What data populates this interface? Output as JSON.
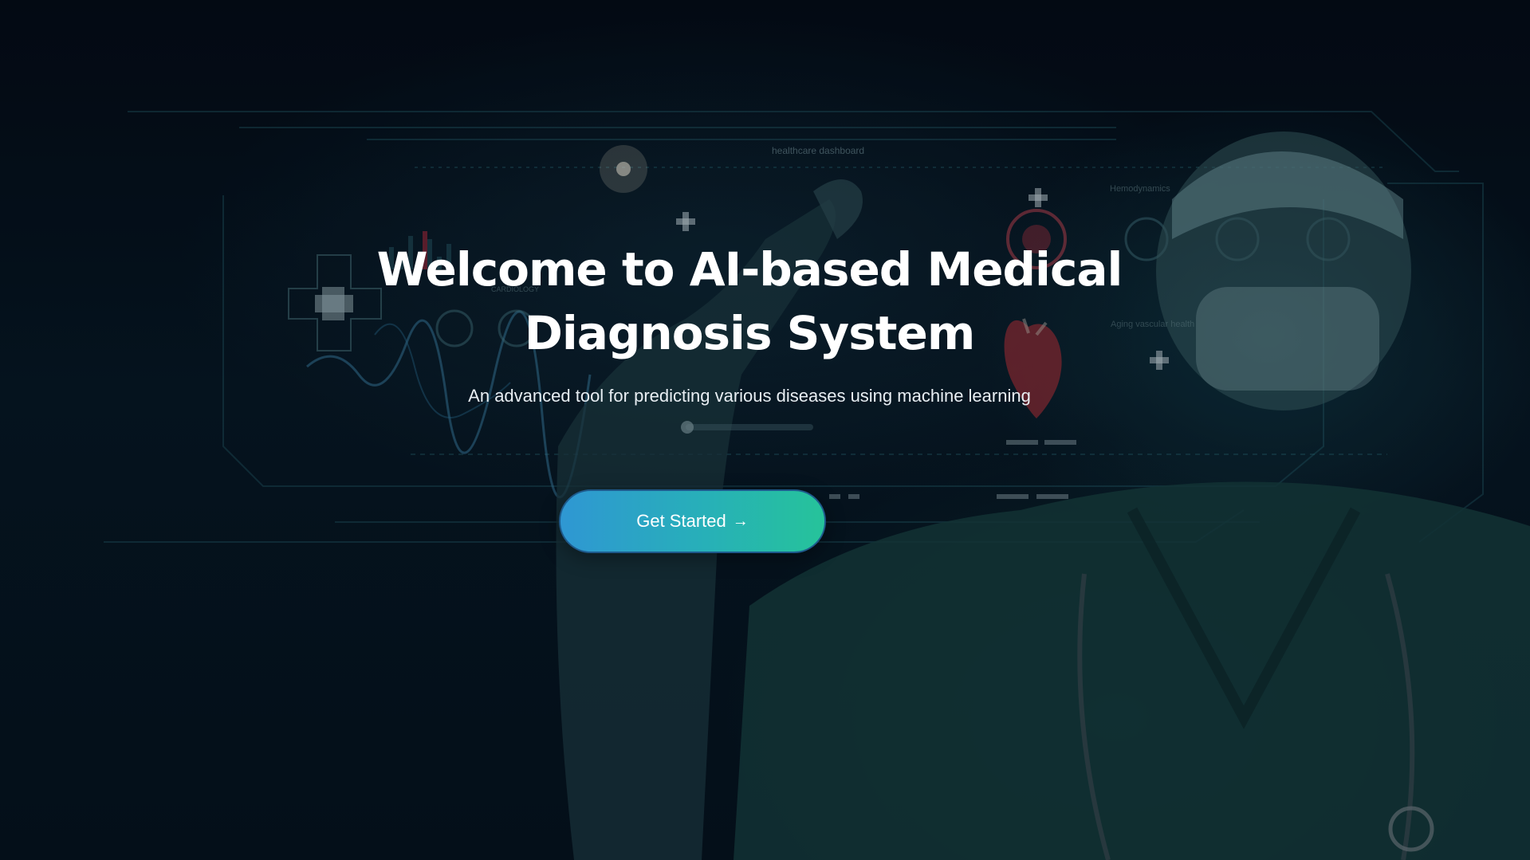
{
  "hero": {
    "title": "Welcome to AI-based Medical Diagnosis System",
    "subtitle": "An advanced tool for predicting various diseases using machine learning",
    "cta_label": "Get Started",
    "cta_arrow": "→"
  },
  "background": {
    "dashboard_label": "healthcare dashboard",
    "cardiology_label": "CARDIOLOGY",
    "hemodynamics_label": "Hemodynamics",
    "vascular_label": "Aging vascular health",
    "icons": [
      "medical-cross-icon",
      "heart-icon",
      "gauge-icon",
      "waveform-icon"
    ]
  },
  "colors": {
    "background": "#050d16",
    "cta_gradient_start": "#2f97d3",
    "cta_gradient_end": "#26c39a",
    "cta_border": "#1e5a8c",
    "title": "#ffffff"
  }
}
